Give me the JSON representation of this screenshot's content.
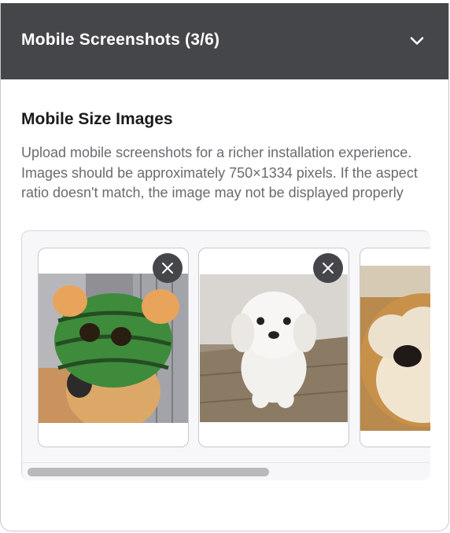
{
  "header": {
    "title": "Mobile Screenshots (3/6)",
    "toggle_icon": "chevron-down-icon"
  },
  "section": {
    "title": "Mobile Size Images",
    "description": "Upload mobile screenshots for a richer installation experience. Images should be approximately 750×1334 pixels. If the aspect ratio doesn't match, the image may not be displayed properly"
  },
  "gallery": {
    "screenshots": [
      {
        "subject": "dog wearing watermelon helmet",
        "removable": true
      },
      {
        "subject": "white fluffy puppy",
        "removable": true
      },
      {
        "subject": "shiba dog covering face",
        "removable": false
      }
    ],
    "scroll_position": 0
  },
  "colors": {
    "header_bg": "#45464a",
    "header_text": "#ffffff",
    "description_text": "#6a6a70"
  }
}
